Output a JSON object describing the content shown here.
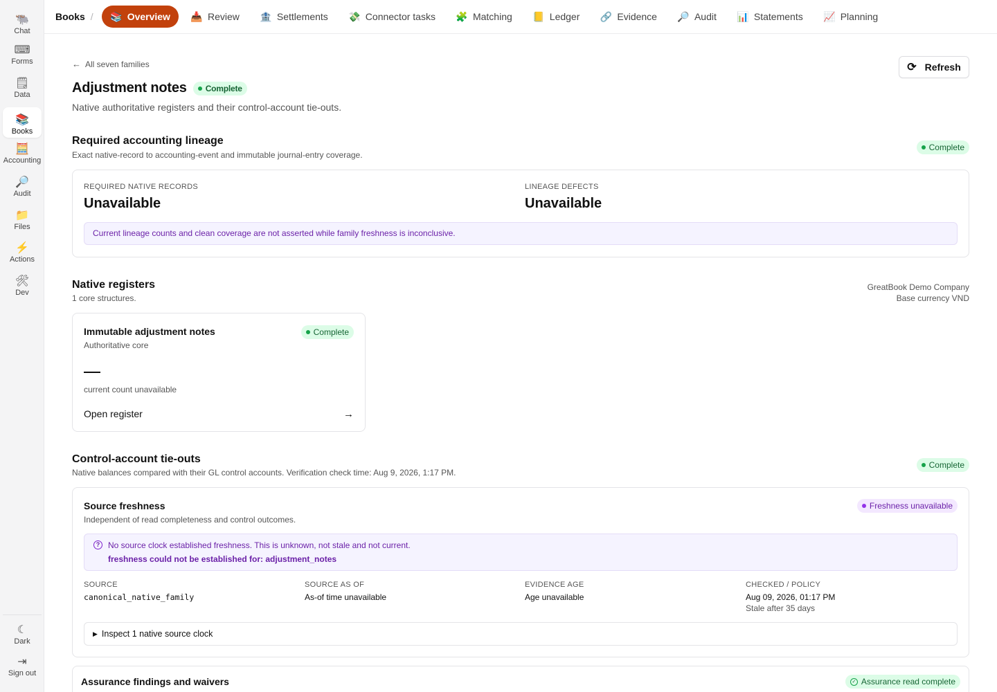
{
  "rail": {
    "items": [
      {
        "label": "Chat",
        "icon": "🐃"
      },
      {
        "label": "Forms",
        "icon": "⌨"
      },
      {
        "label": "Data",
        "icon": "🗒"
      },
      {
        "label": "Books",
        "icon": "📚"
      },
      {
        "label": "Accounting",
        "icon": "🧮"
      },
      {
        "label": "Audit",
        "icon": "🔎"
      },
      {
        "label": "Files",
        "icon": "📁"
      },
      {
        "label": "Actions",
        "icon": "⚡"
      },
      {
        "label": "Dev",
        "icon": "🛠"
      }
    ],
    "bottom": [
      {
        "label": "Dark",
        "icon": "☾"
      },
      {
        "label": "Sign out",
        "icon": "⇥"
      }
    ],
    "active": "Books"
  },
  "topnav": {
    "breadcrumb": "Books",
    "separator": "/",
    "tabs": [
      {
        "label": "Overview",
        "icon": "📚"
      },
      {
        "label": "Review",
        "icon": "📥"
      },
      {
        "label": "Settlements",
        "icon": "🏦"
      },
      {
        "label": "Connector tasks",
        "icon": "💸"
      },
      {
        "label": "Matching",
        "icon": "🧩"
      },
      {
        "label": "Ledger",
        "icon": "📒"
      },
      {
        "label": "Evidence",
        "icon": "🔗"
      },
      {
        "label": "Audit",
        "icon": "🔎"
      },
      {
        "label": "Statements",
        "icon": "📊"
      },
      {
        "label": "Planning",
        "icon": "📈"
      }
    ],
    "active_tab": "Overview",
    "active_color": "#c2410c"
  },
  "header": {
    "back_label": "All seven families",
    "title": "Adjustment notes",
    "status": "Complete",
    "subtitle": "Native authoritative registers and their control-account tie-outs.",
    "refresh_label": "Refresh"
  },
  "lineage": {
    "title": "Required accounting lineage",
    "description": "Exact native-record to accounting-event and immutable journal-entry coverage.",
    "status": "Complete",
    "kpis": [
      {
        "label": "REQUIRED NATIVE RECORDS",
        "value": "Unavailable"
      },
      {
        "label": "LINEAGE DEFECTS",
        "value": "Unavailable"
      }
    ],
    "notice": "Current lineage counts and clean coverage are not asserted while family freshness is inconclusive."
  },
  "registers": {
    "title": "Native registers",
    "description": "1 core structures.",
    "company": "GreatBook Demo Company",
    "currency": "Base currency VND",
    "cards": [
      {
        "title": "Immutable adjustment notes",
        "subtitle": "Authoritative core",
        "status": "Complete",
        "count_note": "current count unavailable",
        "open_label": "Open register"
      }
    ]
  },
  "tieouts": {
    "title": "Control-account tie-outs",
    "description": "Native balances compared with their GL control accounts. Verification check time: Aug 9, 2026, 1:17 PM.",
    "status": "Complete",
    "freshness": {
      "title": "Source freshness",
      "description": "Independent of read completeness and control outcomes.",
      "status": "Freshness unavailable",
      "notice_line1": "No source clock established freshness. This is unknown, not stale and not current.",
      "notice_line2": "freshness could not be established for: adjustment_notes",
      "columns": [
        {
          "label": "SOURCE",
          "value": "canonical_native_family",
          "sub": ""
        },
        {
          "label": "SOURCE AS OF",
          "value": "As-of time unavailable",
          "sub": ""
        },
        {
          "label": "EVIDENCE AGE",
          "value": "Age unavailable",
          "sub": ""
        },
        {
          "label": "CHECKED / POLICY",
          "value": "Aug 09, 2026, 01:17 PM",
          "sub": "Stale after 35 days"
        }
      ],
      "details_label": "Inspect 1 native source clock"
    }
  },
  "assurance": {
    "title": "Assurance findings and waivers",
    "status": "Assurance read complete"
  }
}
